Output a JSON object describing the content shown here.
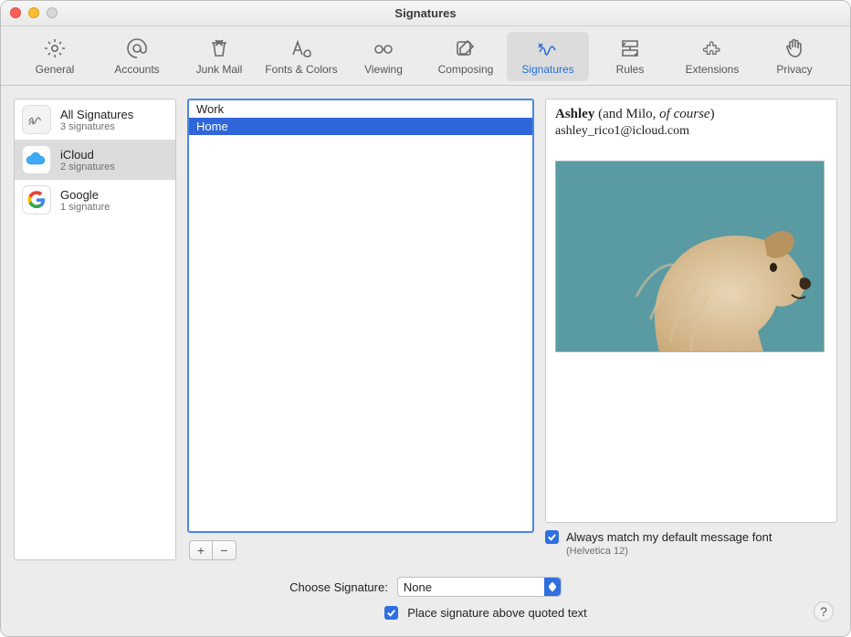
{
  "window": {
    "title": "Signatures"
  },
  "toolbar": {
    "items": [
      {
        "label": "General"
      },
      {
        "label": "Accounts"
      },
      {
        "label": "Junk Mail"
      },
      {
        "label": "Fonts & Colors"
      },
      {
        "label": "Viewing"
      },
      {
        "label": "Composing"
      },
      {
        "label": "Signatures"
      },
      {
        "label": "Rules"
      },
      {
        "label": "Extensions"
      },
      {
        "label": "Privacy"
      }
    ],
    "selected_index": 6
  },
  "accounts": [
    {
      "name": "All Signatures",
      "subtitle": "3 signatures",
      "icon": "signatures"
    },
    {
      "name": "iCloud",
      "subtitle": "2 signatures",
      "icon": "icloud"
    },
    {
      "name": "Google",
      "subtitle": "1 signature",
      "icon": "google"
    }
  ],
  "accounts_selected_index": 1,
  "signatures": [
    {
      "name": "Work"
    },
    {
      "name": "Home"
    }
  ],
  "signatures_selected_index": 1,
  "buttons": {
    "add": "+",
    "remove": "−"
  },
  "preview": {
    "name_bold": "Ashley",
    "name_rest": " (and Milo, ",
    "name_italic": "of course",
    "name_tail": ")",
    "email": "ashley_rico1@icloud.com"
  },
  "match_font": {
    "checked": true,
    "label": "Always match my default message font",
    "sub": "(Helvetica 12)"
  },
  "choose": {
    "label": "Choose Signature:",
    "value": "None"
  },
  "place_above": {
    "checked": true,
    "label": "Place signature above quoted text"
  },
  "help": "?"
}
